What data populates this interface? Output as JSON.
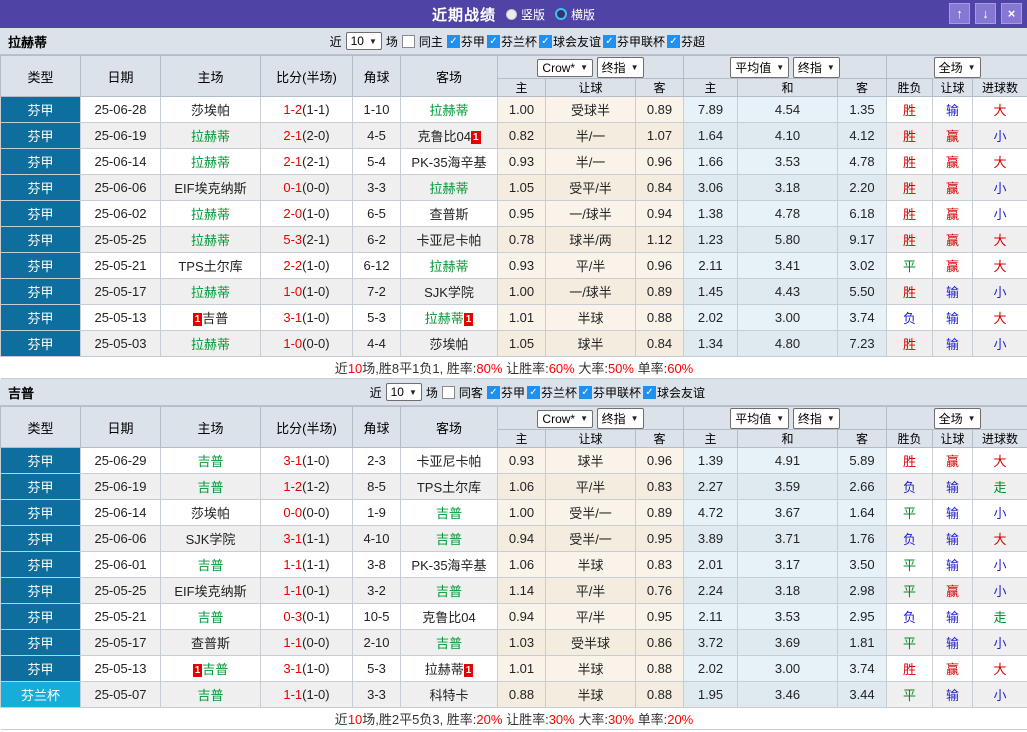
{
  "titlebar": {
    "title": "近期战绩",
    "radio_vertical": "竖版",
    "radio_horizontal": "横版",
    "button_glyphs": {
      "up": "↑",
      "down": "↓",
      "close": "×"
    }
  },
  "colors": {
    "titlebar_bg": "#4f43a5",
    "panel_bg": "#dbe2ea",
    "checkbox_blue": "#2090f0",
    "team_highlight_green": "#009933",
    "score_red": "#e60000",
    "summary_red": "#ff0000"
  },
  "type_colors": {
    "芬甲": "#0e6f9e",
    "芬兰杯": "#16aed8"
  },
  "result_colors": {
    "胜": "#d40000",
    "负": "#1f1fd0",
    "平": "#008822",
    "赢": "#d40000",
    "输": "#1f1fd0",
    "大": "#d40000",
    "小": "#1f1fd0",
    "走": "#008822"
  },
  "header_cols": [
    "类型",
    "日期",
    "主场",
    "比分(半场)",
    "角球",
    "客场"
  ],
  "sub_cols": [
    "主",
    "让球",
    "客",
    "主",
    "和",
    "客",
    "胜负",
    "让球",
    "进球数"
  ],
  "sections": [
    {
      "team": "拉赫蒂",
      "near_label": "近",
      "matches_label": "场",
      "same_checkbox": "同主",
      "leagues": [
        "芬甲",
        "芬兰杯",
        "球会友谊",
        "芬甲联杯",
        "芬超"
      ],
      "dropdowns": {
        "count": "10",
        "odds_source": "Crow*",
        "odds_time": "终指",
        "avg_source": "平均值",
        "avg_time": "终指",
        "scope": "全场"
      },
      "rows": [
        {
          "type": "芬甲",
          "date": "25-06-28",
          "home": {
            "name": "莎埃帕",
            "green": false
          },
          "score": "1-2",
          "half": "(1-1)",
          "corner": "1-10",
          "away": {
            "name": "拉赫蒂",
            "green": true
          },
          "odds": [
            "1.00",
            "受球半",
            "0.89"
          ],
          "avg": [
            "7.89",
            "4.54",
            "1.35"
          ],
          "res": [
            "胜",
            "输",
            "大"
          ]
        },
        {
          "type": "芬甲",
          "date": "25-06-19",
          "home": {
            "name": "拉赫蒂",
            "green": true
          },
          "score": "2-1",
          "half": "(2-0)",
          "corner": "4-5",
          "away": {
            "name": "克鲁比04",
            "green": false,
            "badge_after": "1"
          },
          "odds": [
            "0.82",
            "半/一",
            "1.07"
          ],
          "avg": [
            "1.64",
            "4.10",
            "4.12"
          ],
          "res": [
            "胜",
            "赢",
            "小"
          ]
        },
        {
          "type": "芬甲",
          "date": "25-06-14",
          "home": {
            "name": "拉赫蒂",
            "green": true
          },
          "score": "2-1",
          "half": "(2-1)",
          "corner": "5-4",
          "away": {
            "name": "PK-35海辛基",
            "green": false
          },
          "odds": [
            "0.93",
            "半/一",
            "0.96"
          ],
          "avg": [
            "1.66",
            "3.53",
            "4.78"
          ],
          "res": [
            "胜",
            "赢",
            "大"
          ]
        },
        {
          "type": "芬甲",
          "date": "25-06-06",
          "home": {
            "name": "EIF埃克纳斯",
            "green": false
          },
          "score": "0-1",
          "half": "(0-0)",
          "corner": "3-3",
          "away": {
            "name": "拉赫蒂",
            "green": true
          },
          "odds": [
            "1.05",
            "受平/半",
            "0.84"
          ],
          "avg": [
            "3.06",
            "3.18",
            "2.20"
          ],
          "res": [
            "胜",
            "赢",
            "小"
          ]
        },
        {
          "type": "芬甲",
          "date": "25-06-02",
          "home": {
            "name": "拉赫蒂",
            "green": true
          },
          "score": "2-0",
          "half": "(1-0)",
          "corner": "6-5",
          "away": {
            "name": "查普斯",
            "green": false
          },
          "odds": [
            "0.95",
            "一/球半",
            "0.94"
          ],
          "avg": [
            "1.38",
            "4.78",
            "6.18"
          ],
          "res": [
            "胜",
            "赢",
            "小"
          ]
        },
        {
          "type": "芬甲",
          "date": "25-05-25",
          "home": {
            "name": "拉赫蒂",
            "green": true
          },
          "score": "5-3",
          "half": "(2-1)",
          "corner": "6-2",
          "away": {
            "name": "卡亚尼卡帕",
            "green": false
          },
          "odds": [
            "0.78",
            "球半/两",
            "1.12"
          ],
          "avg": [
            "1.23",
            "5.80",
            "9.17"
          ],
          "res": [
            "胜",
            "赢",
            "大"
          ]
        },
        {
          "type": "芬甲",
          "date": "25-05-21",
          "home": {
            "name": "TPS土尔库",
            "green": false
          },
          "score": "2-2",
          "half": "(1-0)",
          "corner": "6-12",
          "away": {
            "name": "拉赫蒂",
            "green": true
          },
          "odds": [
            "0.93",
            "平/半",
            "0.96"
          ],
          "avg": [
            "2.11",
            "3.41",
            "3.02"
          ],
          "res": [
            "平",
            "赢",
            "大"
          ]
        },
        {
          "type": "芬甲",
          "date": "25-05-17",
          "home": {
            "name": "拉赫蒂",
            "green": true
          },
          "score": "1-0",
          "half": "(1-0)",
          "corner": "7-2",
          "away": {
            "name": "SJK学院",
            "green": false
          },
          "odds": [
            "1.00",
            "一/球半",
            "0.89"
          ],
          "avg": [
            "1.45",
            "4.43",
            "5.50"
          ],
          "res": [
            "胜",
            "输",
            "小"
          ]
        },
        {
          "type": "芬甲",
          "date": "25-05-13",
          "home": {
            "name": "吉普",
            "green": false,
            "badge_before": "1"
          },
          "score": "3-1",
          "half": "(1-0)",
          "corner": "5-3",
          "away": {
            "name": "拉赫蒂",
            "green": true,
            "badge_after": "1"
          },
          "odds": [
            "1.01",
            "半球",
            "0.88"
          ],
          "avg": [
            "2.02",
            "3.00",
            "3.74"
          ],
          "res": [
            "负",
            "输",
            "大"
          ]
        },
        {
          "type": "芬甲",
          "date": "25-05-03",
          "home": {
            "name": "拉赫蒂",
            "green": true
          },
          "score": "1-0",
          "half": "(0-0)",
          "corner": "4-4",
          "away": {
            "name": "莎埃帕",
            "green": false
          },
          "odds": [
            "1.05",
            "球半",
            "0.84"
          ],
          "avg": [
            "1.34",
            "4.80",
            "7.23"
          ],
          "res": [
            "胜",
            "输",
            "小"
          ]
        }
      ],
      "summary": [
        [
          "近",
          "k"
        ],
        [
          "10",
          "r"
        ],
        [
          "场,胜8平1负1, 胜率:",
          "k"
        ],
        [
          "80%",
          "r"
        ],
        [
          " 让胜率:",
          "k"
        ],
        [
          "60%",
          "r"
        ],
        [
          " 大率:",
          "k"
        ],
        [
          "50%",
          "r"
        ],
        [
          " 单率:",
          "k"
        ],
        [
          "60%",
          "r"
        ]
      ]
    },
    {
      "team": "吉普",
      "near_label": "近",
      "matches_label": "场",
      "same_checkbox": "同客",
      "leagues": [
        "芬甲",
        "芬兰杯",
        "芬甲联杯",
        "球会友谊"
      ],
      "dropdowns": {
        "count": "10",
        "odds_source": "Crow*",
        "odds_time": "终指",
        "avg_source": "平均值",
        "avg_time": "终指",
        "scope": "全场"
      },
      "rows": [
        {
          "type": "芬甲",
          "date": "25-06-29",
          "home": {
            "name": "吉普",
            "green": true
          },
          "score": "3-1",
          "half": "(1-0)",
          "corner": "2-3",
          "away": {
            "name": "卡亚尼卡帕",
            "green": false
          },
          "odds": [
            "0.93",
            "球半",
            "0.96"
          ],
          "avg": [
            "1.39",
            "4.91",
            "5.89"
          ],
          "res": [
            "胜",
            "赢",
            "大"
          ]
        },
        {
          "type": "芬甲",
          "date": "25-06-19",
          "home": {
            "name": "吉普",
            "green": true
          },
          "score": "1-2",
          "half": "(1-2)",
          "corner": "8-5",
          "away": {
            "name": "TPS土尔库",
            "green": false
          },
          "odds": [
            "1.06",
            "平/半",
            "0.83"
          ],
          "avg": [
            "2.27",
            "3.59",
            "2.66"
          ],
          "res": [
            "负",
            "输",
            "走"
          ]
        },
        {
          "type": "芬甲",
          "date": "25-06-14",
          "home": {
            "name": "莎埃帕",
            "green": false
          },
          "score": "0-0",
          "half": "(0-0)",
          "corner": "1-9",
          "away": {
            "name": "吉普",
            "green": true
          },
          "odds": [
            "1.00",
            "受半/一",
            "0.89"
          ],
          "avg": [
            "4.72",
            "3.67",
            "1.64"
          ],
          "res": [
            "平",
            "输",
            "小"
          ]
        },
        {
          "type": "芬甲",
          "date": "25-06-06",
          "home": {
            "name": "SJK学院",
            "green": false
          },
          "score": "3-1",
          "half": "(1-1)",
          "corner": "4-10",
          "away": {
            "name": "吉普",
            "green": true
          },
          "odds": [
            "0.94",
            "受半/一",
            "0.95"
          ],
          "avg": [
            "3.89",
            "3.71",
            "1.76"
          ],
          "res": [
            "负",
            "输",
            "大"
          ]
        },
        {
          "type": "芬甲",
          "date": "25-06-01",
          "home": {
            "name": "吉普",
            "green": true
          },
          "score": "1-1",
          "half": "(1-1)",
          "corner": "3-8",
          "away": {
            "name": "PK-35海辛基",
            "green": false
          },
          "odds": [
            "1.06",
            "半球",
            "0.83"
          ],
          "avg": [
            "2.01",
            "3.17",
            "3.50"
          ],
          "res": [
            "平",
            "输",
            "小"
          ]
        },
        {
          "type": "芬甲",
          "date": "25-05-25",
          "home": {
            "name": "EIF埃克纳斯",
            "green": false
          },
          "score": "1-1",
          "half": "(0-1)",
          "corner": "3-2",
          "away": {
            "name": "吉普",
            "green": true
          },
          "odds": [
            "1.14",
            "平/半",
            "0.76"
          ],
          "avg": [
            "2.24",
            "3.18",
            "2.98"
          ],
          "res": [
            "平",
            "赢",
            "小"
          ]
        },
        {
          "type": "芬甲",
          "date": "25-05-21",
          "home": {
            "name": "吉普",
            "green": true
          },
          "score": "0-3",
          "half": "(0-1)",
          "corner": "10-5",
          "away": {
            "name": "克鲁比04",
            "green": false
          },
          "odds": [
            "0.94",
            "平/半",
            "0.95"
          ],
          "avg": [
            "2.11",
            "3.53",
            "2.95"
          ],
          "res": [
            "负",
            "输",
            "走"
          ]
        },
        {
          "type": "芬甲",
          "date": "25-05-17",
          "home": {
            "name": "查普斯",
            "green": false
          },
          "score": "1-1",
          "half": "(0-0)",
          "corner": "2-10",
          "away": {
            "name": "吉普",
            "green": true
          },
          "odds": [
            "1.03",
            "受半球",
            "0.86"
          ],
          "avg": [
            "3.72",
            "3.69",
            "1.81"
          ],
          "res": [
            "平",
            "输",
            "小"
          ]
        },
        {
          "type": "芬甲",
          "date": "25-05-13",
          "home": {
            "name": "吉普",
            "green": true,
            "badge_before": "1"
          },
          "score": "3-1",
          "half": "(1-0)",
          "corner": "5-3",
          "away": {
            "name": "拉赫蒂",
            "green": false,
            "badge_after": "1"
          },
          "odds": [
            "1.01",
            "半球",
            "0.88"
          ],
          "avg": [
            "2.02",
            "3.00",
            "3.74"
          ],
          "res": [
            "胜",
            "赢",
            "大"
          ]
        },
        {
          "type": "芬兰杯",
          "date": "25-05-07",
          "home": {
            "name": "吉普",
            "green": true
          },
          "score": "1-1",
          "half": "(1-0)",
          "corner": "3-3",
          "away": {
            "name": "科特卡",
            "green": false
          },
          "odds": [
            "0.88",
            "半球",
            "0.88"
          ],
          "avg": [
            "1.95",
            "3.46",
            "3.44"
          ],
          "res": [
            "平",
            "输",
            "小"
          ]
        }
      ],
      "summary": [
        [
          "近",
          "k"
        ],
        [
          "10",
          "r"
        ],
        [
          "场,胜2平5负3, 胜率:",
          "k"
        ],
        [
          "20%",
          "r"
        ],
        [
          " 让胜率:",
          "k"
        ],
        [
          "30%",
          "r"
        ],
        [
          " 大率:",
          "k"
        ],
        [
          "30%",
          "r"
        ],
        [
          " 单率:",
          "k"
        ],
        [
          "20%",
          "r"
        ]
      ]
    }
  ]
}
